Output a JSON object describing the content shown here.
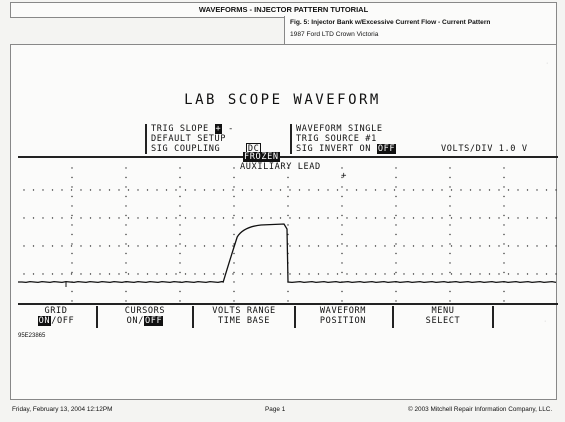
{
  "header": {
    "title": "WAVEFORMS - INJECTOR PATTERN TUTORIAL"
  },
  "caption": {
    "title": "Fig. 5: Injector Bank w/Excessive Current Flow - Current Pattern",
    "vehicle": "1987 Ford LTD Crown Victoria"
  },
  "scope": {
    "title": "LAB SCOPE WAVEFORM",
    "settings": {
      "trig_slope_label": "TRIG SLOPE",
      "trig_slope_selected": "+",
      "trig_slope_other": "-",
      "default_setup": "DEFAULT SETUP",
      "sig_coupling_label": "SIG COUPLING",
      "sig_coupling_value": "DC",
      "waveform_label": "WAVEFORM",
      "waveform_value": "SINGLE",
      "trig_source_label": "TRIG SOURCE",
      "trig_source_value": "#1",
      "sig_invert_label": "SIG INVERT",
      "sig_invert_on": "ON",
      "sig_invert_off": "OFF",
      "volts_div": "VOLTS/DIV 1.0 V"
    },
    "status": "FROZEN",
    "channel": "AUXILIARY LEAD",
    "trigger_marker": "+",
    "waveform": {
      "baseline_level": 0,
      "peak_level": 1.5,
      "rise_start_fraction": 0.38,
      "peak_start_fraction": 0.45,
      "fall_fraction": 0.5
    },
    "menu": {
      "grid_label": "GRID",
      "grid_on": "ON",
      "grid_off": "OFF",
      "cursors_label": "CURSORS",
      "cursors_on": "ON",
      "cursors_off": "OFF",
      "volts_range": "VOLTS RANGE",
      "time_base": "TIME BASE",
      "waveform_label": "WAVEFORM",
      "position": "POSITION",
      "menu_label": "MENU",
      "select": "SELECT"
    }
  },
  "figure_id": "95E23865",
  "footer": {
    "date": "Friday, February 13, 2004  12:12PM",
    "page": "Page 1",
    "copyright": "© 2003 Mitchell Repair Information Company, LLC."
  }
}
